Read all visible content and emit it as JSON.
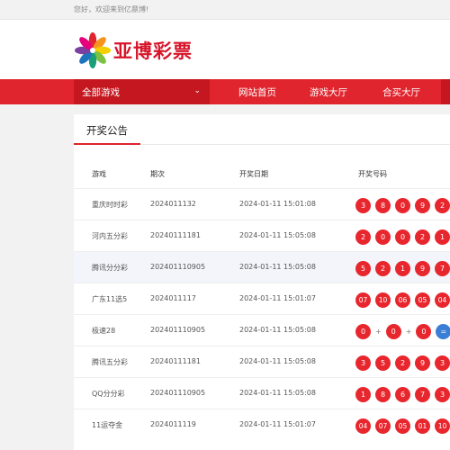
{
  "topbar": {
    "welcome": "您好，欢迎来到亿鼎博!"
  },
  "brand": {
    "name": "亚博彩票"
  },
  "nav": {
    "all_games": "全部游戏",
    "links": [
      "网站首页",
      "游戏大厅",
      "合买大厅"
    ]
  },
  "panel": {
    "title": "开奖公告"
  },
  "table": {
    "headers": [
      "游戏",
      "期次",
      "开奖日期",
      "开奖号码"
    ],
    "rows": [
      {
        "game": "重庆时时彩",
        "issue": "2024011132",
        "date": "2024-01-11 15:01:08",
        "numbers": [
          "3",
          "8",
          "0",
          "9",
          "2"
        ]
      },
      {
        "game": "河内五分彩",
        "issue": "20240111181",
        "date": "2024-01-11 15:05:08",
        "numbers": [
          "2",
          "0",
          "0",
          "2",
          "1"
        ]
      },
      {
        "game": "腾讯分分彩",
        "issue": "202401110905",
        "date": "2024-01-11 15:05:08",
        "numbers": [
          "5",
          "2",
          "1",
          "9",
          "7"
        ]
      },
      {
        "game": "广东11选5",
        "issue": "2024011117",
        "date": "2024-01-11 15:01:07",
        "numbers": [
          "07",
          "10",
          "06",
          "05",
          "04"
        ]
      },
      {
        "game": "极速28",
        "issue": "202401110905",
        "date": "2024-01-11 15:05:08",
        "numbers": [
          "0",
          "+",
          "0",
          "+",
          "0",
          "="
        ]
      },
      {
        "game": "腾讯五分彩",
        "issue": "20240111181",
        "date": "2024-01-11 15:05:08",
        "numbers": [
          "3",
          "5",
          "2",
          "9",
          "3"
        ]
      },
      {
        "game": "QQ分分彩",
        "issue": "202401110905",
        "date": "2024-01-11 15:05:08",
        "numbers": [
          "1",
          "8",
          "6",
          "7",
          "3"
        ]
      },
      {
        "game": "11运夺金",
        "issue": "2024011119",
        "date": "2024-01-11 15:01:07",
        "numbers": [
          "04",
          "07",
          "05",
          "01",
          "10"
        ]
      }
    ]
  },
  "colors": {
    "accent": "#e0252e",
    "nav_dark": "#c4171f",
    "ball_red": "#e8262d",
    "ball_blue": "#3a7fd5"
  }
}
